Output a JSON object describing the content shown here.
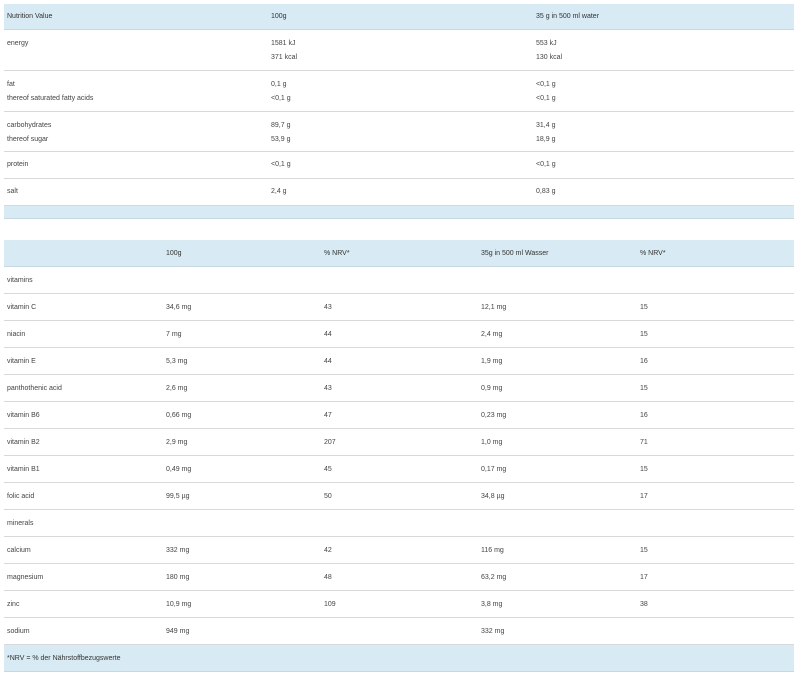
{
  "table1": {
    "headers": [
      "Nutrition Value",
      "100g",
      "35 g in 500 ml water"
    ],
    "rows": [
      {
        "labels": [
          "energy"
        ],
        "per100": [
          "1581 kJ",
          "371 kcal"
        ],
        "perServing": [
          "553 kJ",
          "130 kcal"
        ]
      },
      {
        "labels": [
          "fat",
          "thereof saturated fatty acids"
        ],
        "per100": [
          "0,1 g",
          "<0,1 g"
        ],
        "perServing": [
          "<0,1 g",
          "<0,1 g"
        ]
      },
      {
        "labels": [
          "carbohydrates",
          "thereof sugar"
        ],
        "per100": [
          "89,7 g",
          "53,9 g"
        ],
        "perServing": [
          "31,4 g",
          "18,9 g"
        ]
      },
      {
        "labels": [
          "protein"
        ],
        "per100": [
          "<0,1 g"
        ],
        "perServing": [
          "<0,1 g"
        ]
      },
      {
        "labels": [
          "salt"
        ],
        "per100": [
          "2,4 g"
        ],
        "perServing": [
          "0,83 g"
        ]
      }
    ]
  },
  "table2": {
    "headers": [
      "",
      "100g",
      "% NRV*",
      "35g in 500 ml Wasser",
      "% NRV*"
    ],
    "rows": [
      [
        "vitamins",
        "",
        "",
        "",
        ""
      ],
      [
        "vitamin C",
        "34,6 mg",
        "43",
        "12,1 mg",
        "15"
      ],
      [
        "niacin",
        "7 mg",
        "44",
        "2,4 mg",
        "15"
      ],
      [
        "vitamin E",
        "5,3 mg",
        "44",
        "1,9 mg",
        "16"
      ],
      [
        "panthothenic acid",
        "2,6 mg",
        "43",
        "0,9 mg",
        "15"
      ],
      [
        "vitamin B6",
        "0,66 mg",
        "47",
        "0,23 mg",
        "16"
      ],
      [
        "vitamin B2",
        "2,9 mg",
        "207",
        "1,0 mg",
        "71"
      ],
      [
        "vitamin B1",
        "0,49 mg",
        "45",
        "0,17 mg",
        "15"
      ],
      [
        "folic acid",
        "99,5 µg",
        "50",
        "34,8 µg",
        "17"
      ],
      [
        "minerals",
        "",
        "",
        "",
        ""
      ],
      [
        "calcium",
        "332 mg",
        "42",
        "116 mg",
        "15"
      ],
      [
        "magnesium",
        "180 mg",
        "48",
        "63,2 mg",
        "17"
      ],
      [
        "zinc",
        "10,9 mg",
        "109",
        "3,8 mg",
        "38"
      ],
      [
        "sodium",
        "949 mg",
        "",
        "332 mg",
        ""
      ]
    ],
    "footnote": "*NRV = % der Nährstoffbezugswerte"
  }
}
